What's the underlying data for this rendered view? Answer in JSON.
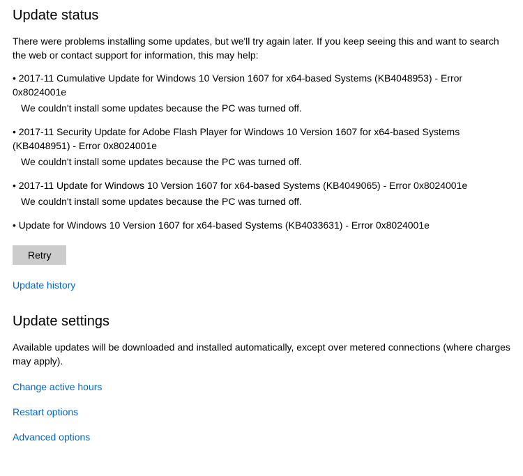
{
  "status": {
    "title": "Update status",
    "intro": "There were problems installing some updates, but we'll try again later. If you keep seeing this and want to search the web or contact support for information, this may help:",
    "updates": [
      {
        "title": "2017-11 Cumulative Update for Windows 10 Version 1607 for x64-based Systems (KB4048953) - Error 0x8024001e",
        "reason": "We couldn't install some updates because the PC was turned off."
      },
      {
        "title": "2017-11 Security Update for Adobe Flash Player for Windows 10 Version 1607 for x64-based Systems (KB4048951) - Error 0x8024001e",
        "reason": "We couldn't install some updates because the PC was turned off."
      },
      {
        "title": "2017-11 Update for Windows 10 Version 1607 for x64-based Systems (KB4049065) - Error 0x8024001e",
        "reason": "We couldn't install some updates because the PC was turned off."
      },
      {
        "title": "Update for Windows 10 Version 1607 for x64-based Systems (KB4033631) - Error 0x8024001e",
        "reason": ""
      }
    ],
    "retry_label": "Retry",
    "history_link": "Update history"
  },
  "settings": {
    "title": "Update settings",
    "intro": "Available updates will be downloaded and installed automatically, except over metered connections (where charges may apply).",
    "links": {
      "active_hours": "Change active hours",
      "restart": "Restart options",
      "advanced": "Advanced options"
    }
  }
}
